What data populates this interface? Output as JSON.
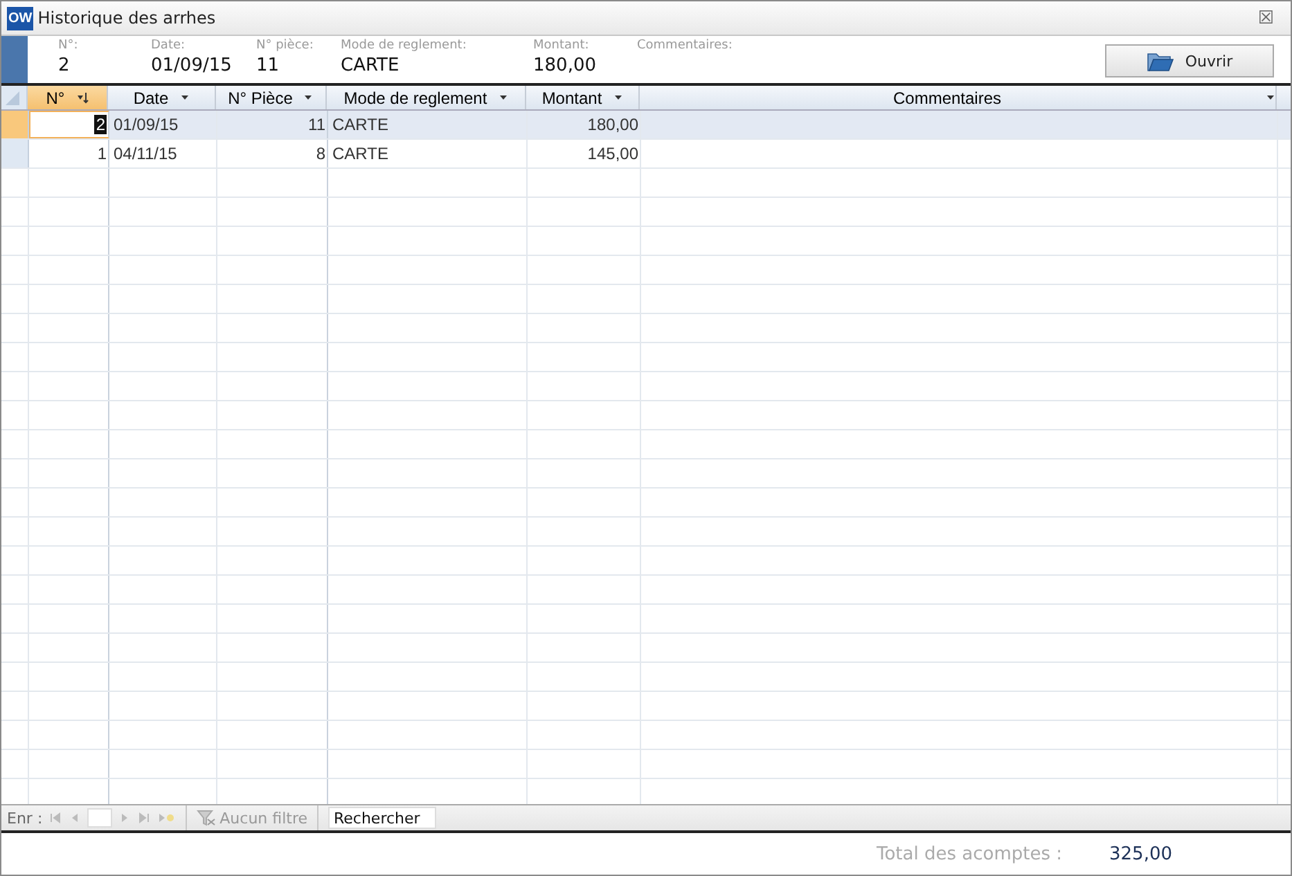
{
  "window": {
    "title": "Historique des arrhes",
    "app_badge": "OW",
    "close": "☒"
  },
  "header_fields": [
    {
      "label": "N°:",
      "value": "2"
    },
    {
      "label": "Date:",
      "value": "01/09/15"
    },
    {
      "label": "N° pièce:",
      "value": "11"
    },
    {
      "label": "Mode de reglement:",
      "value": "CARTE"
    },
    {
      "label": "Montant:",
      "value": "180,00"
    },
    {
      "label": "Commentaires:"
    }
  ],
  "open_button": "Ouvrir",
  "table": {
    "columns": [
      {
        "label": "N°",
        "sorted": true
      },
      {
        "label": "Date",
        "sorted": false
      },
      {
        "label": "N° Pièce",
        "sorted": false
      },
      {
        "label": "Mode de reglement",
        "sorted": false
      },
      {
        "label": "Montant",
        "sorted": false
      },
      {
        "label": "Commentaires",
        "sorted": false
      }
    ],
    "rows": [
      {
        "selected": true,
        "cells": [
          "2",
          "01/09/15",
          "11",
          "CARTE",
          "180,00",
          ""
        ]
      },
      {
        "selected": false,
        "cells": [
          "1",
          "04/11/15",
          "8",
          "CARTE",
          "145,00",
          ""
        ]
      }
    ]
  },
  "nav_bar": {
    "label": "Enr :",
    "filter": "Aucun filtre",
    "search": "Rechercher"
  },
  "footer": {
    "total_label": "Total des acomptes :",
    "total_value": "325,00"
  }
}
